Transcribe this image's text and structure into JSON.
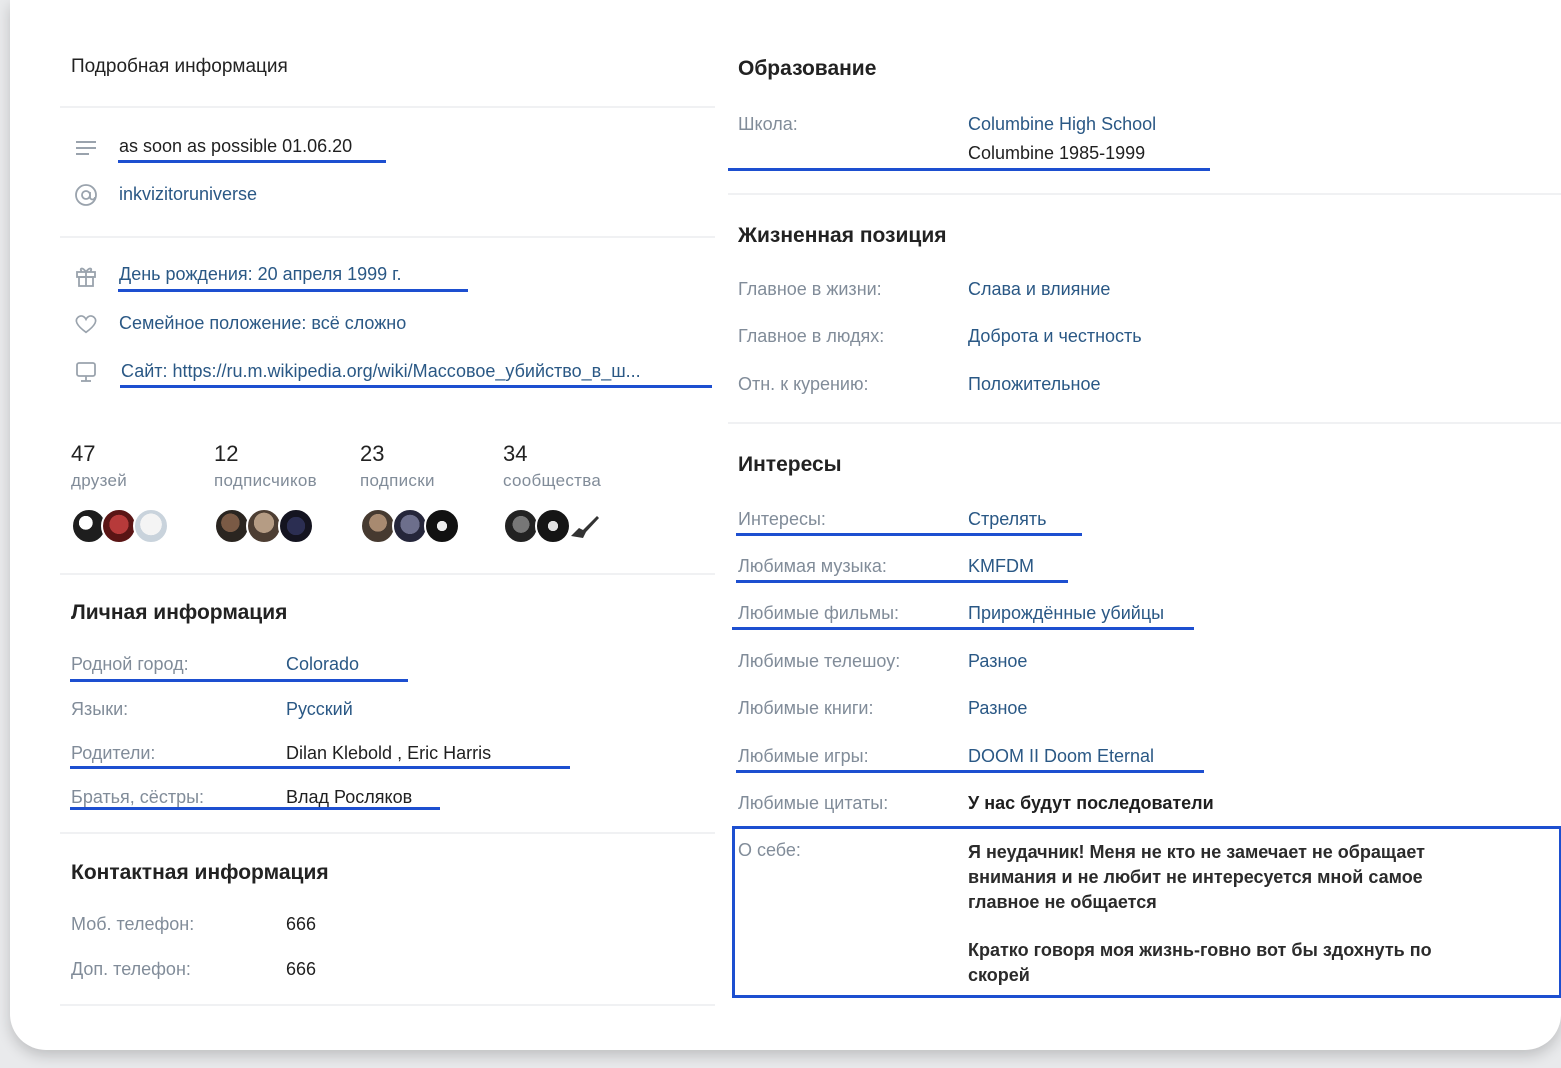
{
  "left": {
    "details_title": "Подробная информация",
    "status": "as soon as possible 01.06.20",
    "username": "inkvizitoruniverse",
    "birthday": "День рождения: 20 апреля 1999 г.",
    "relationship": "Семейное положение: всё сложно",
    "website": "Сайт: https://ru.m.wikipedia.org/wiki/Массовое_убийство_в_ш...",
    "stats": [
      {
        "count": "47",
        "label": "друзей"
      },
      {
        "count": "12",
        "label": "подписчиков"
      },
      {
        "count": "23",
        "label": "подписки"
      },
      {
        "count": "34",
        "label": "сообщества"
      }
    ],
    "personal_title": "Личная информация",
    "personal": [
      {
        "label": "Родной город:",
        "value": "Colorado"
      },
      {
        "label": "Языки:",
        "value": "Русский"
      },
      {
        "label": "Родители:",
        "value": "Dilan Klebold , Eric Harris"
      },
      {
        "label": "Братья, сёстры:",
        "value": "Влад Росляков"
      }
    ],
    "contact_title": "Контактная информация",
    "contact": [
      {
        "label": "Моб. телефон:",
        "value": "666"
      },
      {
        "label": "Доп. телефон:",
        "value": "666"
      }
    ]
  },
  "right": {
    "education_title": "Образование",
    "school_label": "Школа:",
    "school_name": "Columbine High School",
    "school_years": "Columbine 1985-1999",
    "life_title": "Жизненная позиция",
    "life": [
      {
        "label": "Главное в жизни:",
        "value": "Слава и влияние"
      },
      {
        "label": "Главное в людях:",
        "value": "Доброта и честность"
      },
      {
        "label": "Отн. к курению:",
        "value": "Положительное"
      }
    ],
    "interests_title": "Интересы",
    "interests": [
      {
        "label": "Интересы:",
        "value": "Стрелять"
      },
      {
        "label": "Любимая музыка:",
        "value": "KMFDM"
      },
      {
        "label": "Любимые фильмы:",
        "value": "Прирождённые убийцы"
      },
      {
        "label": "Любимые телешоу:",
        "value": "Разное"
      },
      {
        "label": "Любимые книги:",
        "value": "Разное"
      },
      {
        "label": "Любимые игры:",
        "value": "DOOM II Doom Eternal"
      },
      {
        "label": "Любимые цитаты:",
        "value": "У нас будут последователи"
      }
    ],
    "about_label": "О себе:",
    "about_p1_lines": [
      "Я неудачник! Меня не кто не замечает не обращает",
      "внимания и не любит не интересуется мной самое",
      "главное не общается"
    ],
    "about_p2_lines": [
      "Кратко говоря моя жизнь-говно вот бы здохнуть по",
      "скорей"
    ]
  },
  "icons": [
    "menu-lines-icon",
    "at-sign-icon",
    "gift-icon",
    "heart-icon",
    "monitor-icon"
  ],
  "colors": {
    "accent_underline": "#1d4fd0",
    "link": "#2a5885",
    "muted": "#818c99"
  }
}
